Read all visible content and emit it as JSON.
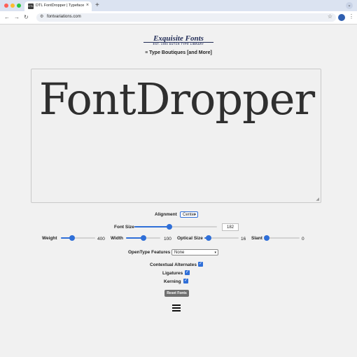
{
  "browser": {
    "tab_title": "DTL FontDropper | Typeface",
    "tab_favicon": "DTL",
    "url": "fontvariations.com",
    "traffic_lights": [
      "#ff5f57",
      "#febc2e",
      "#28c840"
    ]
  },
  "header": {
    "logo_main": "Exquisite Fonts",
    "logo_sub": "EST. 1990 DUTCH TYPE LIBRARY",
    "boutiques": "≡ Type Boutiques [and More]"
  },
  "preview": {
    "text": "FontDropper"
  },
  "controls": {
    "alignment_label": "Alignment",
    "alignment_value": "Center",
    "font_size_label": "Font Size",
    "font_size_value": "182",
    "font_size_fraction": 0.42,
    "weight_label": "Weight",
    "weight_value": "400",
    "weight_fraction": 0.33,
    "width_label": "Width",
    "width_value": "100",
    "width_fraction": 0.5,
    "optical_label": "Optical Size",
    "optical_value": "16",
    "optical_fraction": 0.12,
    "slant_label": "Slant",
    "slant_value": "0",
    "slant_fraction": 0.0,
    "opentype_label": "OpenType Features",
    "opentype_value": "None",
    "contextual_label": "Contextual Alternates",
    "ligatures_label": "Ligatures",
    "kerning_label": "Kerning",
    "reset_label": "Reset Fonts"
  },
  "colors": {
    "accent": "#2f6fd8"
  }
}
